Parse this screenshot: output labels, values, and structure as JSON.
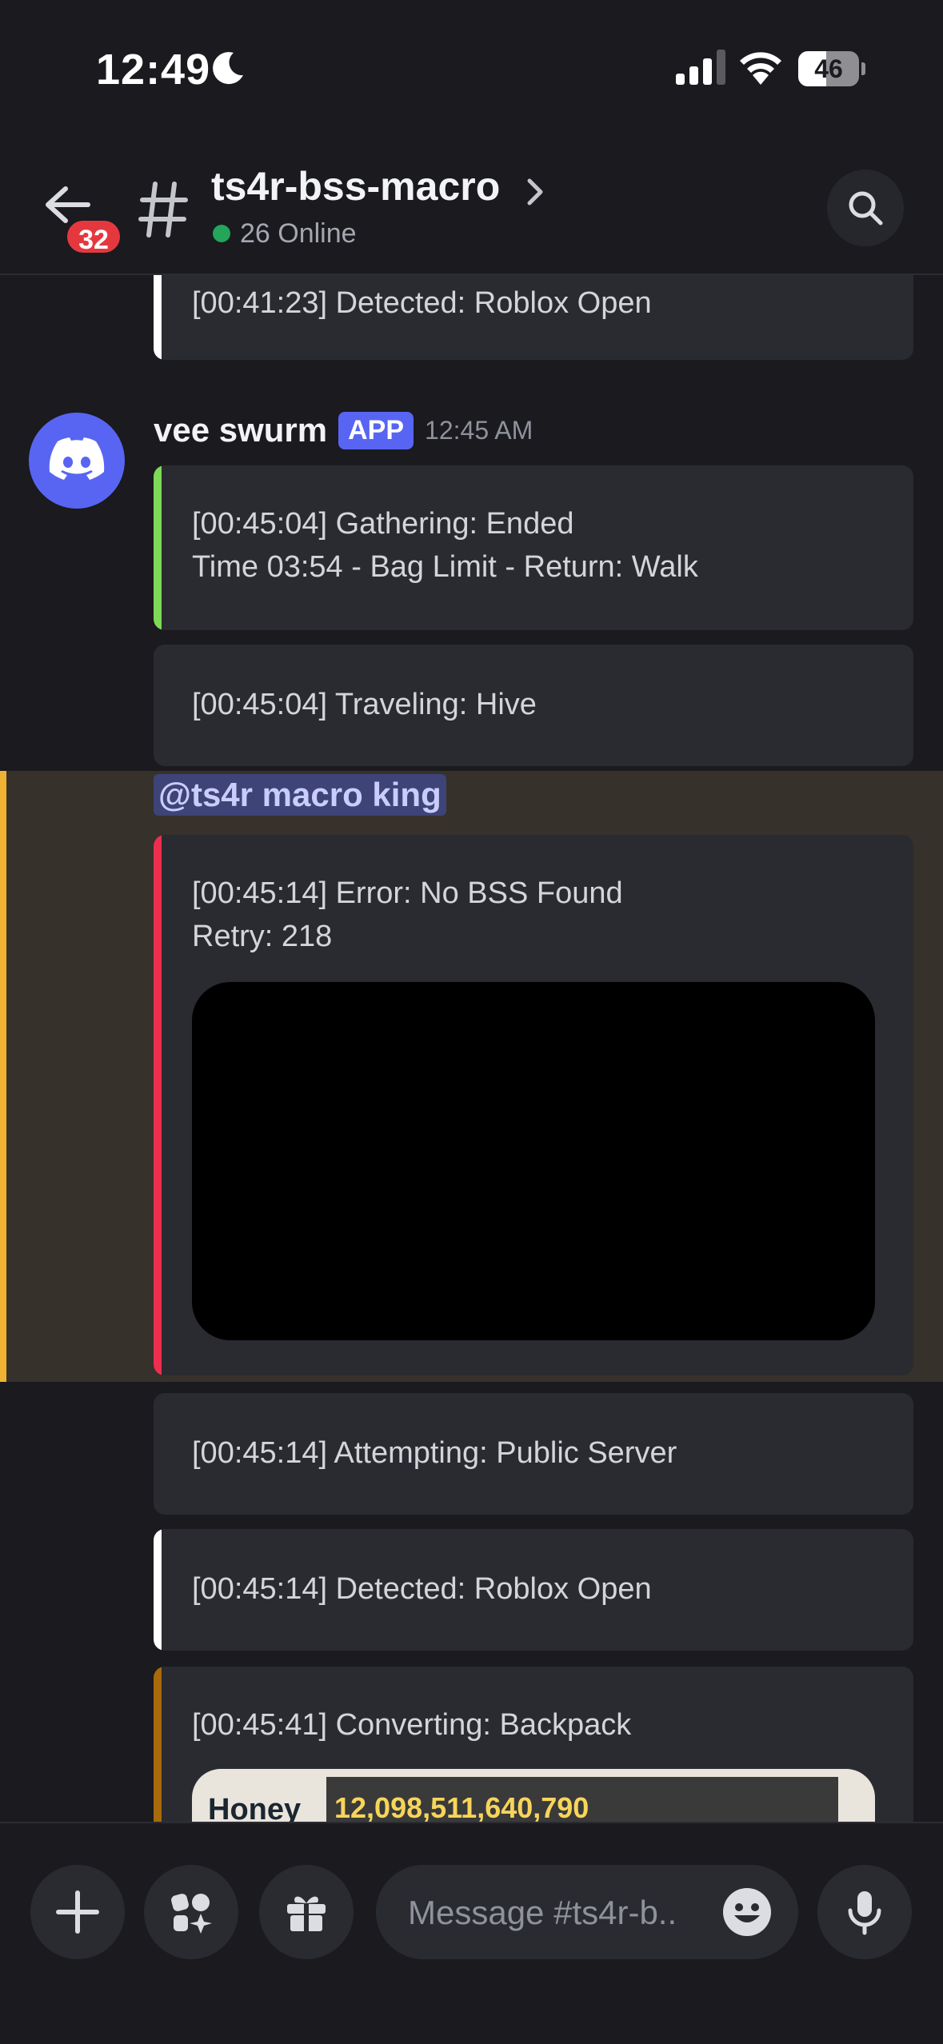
{
  "status_bar": {
    "time": "12:49",
    "battery": "46",
    "battery_level": 0.46
  },
  "header": {
    "unread_badge": "32",
    "channel_name": "ts4r-bss-macro",
    "online_text": "26 Online"
  },
  "messages": {
    "top_embed": {
      "text": "[00:41:23] Detected: Roblox Open",
      "bar_color": "#ffffff"
    },
    "author": {
      "name": "vee swurm",
      "tag": "APP",
      "timestamp": "12:45 AM"
    },
    "embeds": [
      {
        "line1": "[00:45:04] Gathering: Ended",
        "line2": "Time 03:54 - Bag Limit - Return: Walk",
        "bar_color": "#7ed957"
      },
      {
        "line1": "[00:45:04] Traveling: Hive"
      }
    ],
    "mention": "@ts4r macro king",
    "error_embed": {
      "line1": "[00:45:14] Error: No BSS Found",
      "line2": "Retry: 218",
      "bar_color": "#ed2e4e"
    },
    "after_embeds": [
      {
        "line1": "[00:45:14] Attempting: Public Server"
      },
      {
        "line1": "[00:45:14] Detected: Roblox Open",
        "bar_color": "#ffffff"
      },
      {
        "line1": "[00:45:41] Converting: Backpack",
        "bar_color": "#a86a0a"
      }
    ],
    "honey_image": {
      "label": "Honey",
      "value": "12,098,511,640,790"
    }
  },
  "composer": {
    "placeholder": "Message #ts4r-b.."
  },
  "colors": {
    "accent": "#5865f2",
    "mention_highlight": "#f0b232",
    "online": "#23a55a",
    "badge": "#e5383e"
  }
}
